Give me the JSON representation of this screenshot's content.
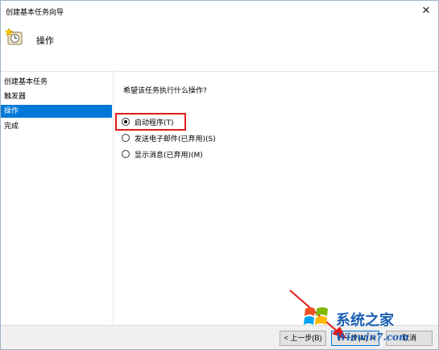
{
  "window": {
    "title": "创建基本任务向导",
    "close_symbol": "✕"
  },
  "header": {
    "icon": "task-scheduler-icon",
    "title": "操作"
  },
  "sidebar": {
    "items": [
      {
        "label": "创建基本任务",
        "selected": false
      },
      {
        "label": "触发器",
        "selected": false
      },
      {
        "label": "操作",
        "selected": true
      },
      {
        "label": "完成",
        "selected": false
      }
    ]
  },
  "main": {
    "question": "希望该任务执行什么操作?",
    "options": [
      {
        "label": "启动程序(T)",
        "checked": true
      },
      {
        "label": "发送电子邮件(已弃用)(S)",
        "checked": false
      },
      {
        "label": "显示消息(已弃用)(M)",
        "checked": false
      }
    ]
  },
  "footer": {
    "back_label": "< 上一步(B)",
    "next_label": "下一步(N) >",
    "cancel_label": "取消"
  },
  "annotation": {
    "color": "#e11b1b"
  },
  "watermark": {
    "brand": "系统之家",
    "url": "Winwin7.com"
  }
}
